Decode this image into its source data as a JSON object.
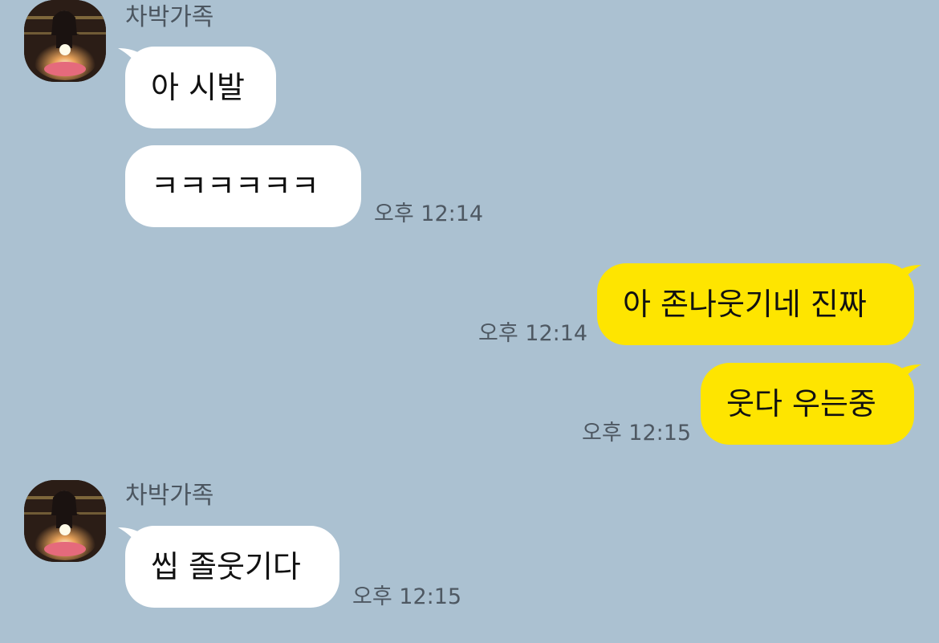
{
  "colors": {
    "background": "#abc1d1",
    "incoming_bubble": "#ffffff",
    "outgoing_bubble": "#fee500"
  },
  "groups": [
    {
      "sender": "차박가족",
      "avatar": "profile-photo-birthday-cake",
      "messages": [
        "아 시발",
        "ㅋㅋㅋㅋㅋㅋ"
      ],
      "time": "오후 12:14"
    },
    {
      "sender": "me",
      "messages": [
        "아 존나웃기네 진짜"
      ],
      "time": "오후 12:14"
    },
    {
      "sender": "me",
      "messages": [
        "웃다 우는중"
      ],
      "time": "오후 12:15"
    },
    {
      "sender": "차박가족",
      "avatar": "profile-photo-birthday-cake",
      "messages": [
        "씹 졸웃기다"
      ],
      "time": "오후 12:15"
    }
  ]
}
